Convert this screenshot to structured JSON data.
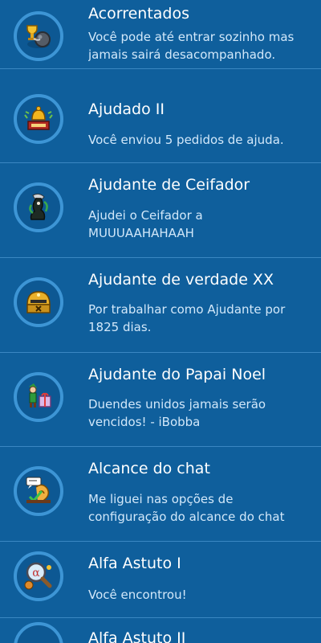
{
  "colors": {
    "background": "#0f5f9c",
    "divider": "#3a87c2",
    "badge_ring": "#3d95d5",
    "title_text": "#ffffff",
    "description_text": "#d2e8fa"
  },
  "badges": [
    {
      "title": "Acorrentados",
      "description": [
        "Você pode até entrar sozinho mas",
        "jamais sairá desacompanhado."
      ],
      "icon": "chained-ball-trophy-icon"
    },
    {
      "title": "Ajudado II",
      "description": [
        "Você enviou 5 pedidos de ajuda."
      ],
      "icon": "helper-bell-icon"
    },
    {
      "title": "Ajudante de Ceifador",
      "description": [
        "Ajudei o Ceifador a",
        "MUUUAAHAHAAH"
      ],
      "icon": "reaper-icon"
    },
    {
      "title": "Ajudante de verdade XX",
      "description": [
        "Por trabalhar como Ajudante por",
        "1825 dias."
      ],
      "icon": "golden-helmet-icon"
    },
    {
      "title": "Ajudante do Papai Noel",
      "description": [
        "Duendes unidos jamais serão",
        "vencidos! - iBobba"
      ],
      "icon": "elf-gift-icon"
    },
    {
      "title": "Alcance do chat",
      "description": [
        "Me liguei nas opções de",
        "configuração do alcance do chat"
      ],
      "icon": "chat-ear-icon"
    },
    {
      "title": "Alfa Astuto I",
      "description": [
        "Você encontrou!"
      ],
      "icon": "magnifier-alpha-icon"
    },
    {
      "title": "Alfa Astuto II",
      "description": [],
      "icon": "magnifier-alpha-icon"
    }
  ]
}
